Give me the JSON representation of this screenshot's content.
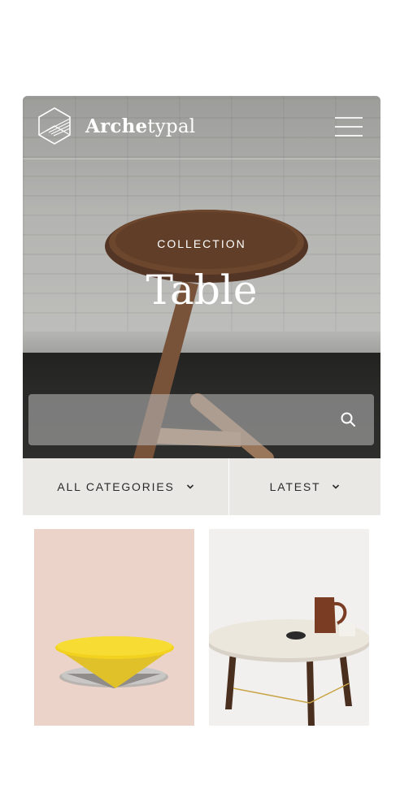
{
  "brand": {
    "name_bold": "Arche",
    "name_light": "typal"
  },
  "hero": {
    "label": "COLLECTION",
    "title": "Table"
  },
  "search": {
    "placeholder": "",
    "value": ""
  },
  "filters": {
    "category_label": "ALL CATEGORIES",
    "sort_label": "LATEST"
  },
  "icons": {
    "logo": "geometric-hexagon-logo-icon",
    "menu": "hamburger-menu-icon",
    "search": "magnifier-search-icon",
    "dropdown": "chevron-down-icon"
  },
  "colors": {
    "filter_bar": "#e9e8e4",
    "product_1_bg": "#ecd3c9",
    "product_2_bg": "#f1f0ee",
    "text_dark": "#2a2a2a"
  },
  "products": [
    {
      "image": "yellow-cone-side-table"
    },
    {
      "image": "round-marble-coffee-table"
    }
  ]
}
